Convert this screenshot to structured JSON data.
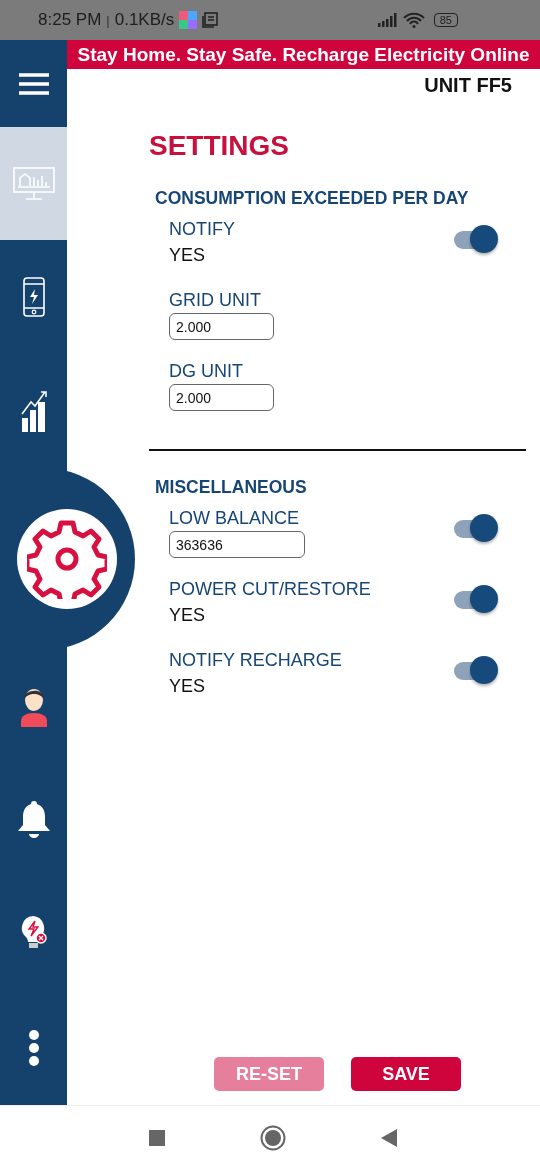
{
  "status_bar": {
    "time": "8:25 PM",
    "separator": "|",
    "speed": "0.1KB/s",
    "battery": "85"
  },
  "banner": "Stay Home. Stay Safe. Recharge Electricity Online",
  "unit": "UNIT FF5",
  "title": "SETTINGS",
  "sidebar": {
    "items": [
      {
        "selected": false,
        "highlighted": true
      },
      {
        "selected": false,
        "highlighted": false
      },
      {
        "selected": false,
        "highlighted": false
      },
      {
        "selected": true,
        "highlighted": false
      },
      {
        "selected": false,
        "highlighted": false
      },
      {
        "selected": false,
        "highlighted": false
      },
      {
        "selected": false,
        "highlighted": false
      },
      {
        "selected": false,
        "highlighted": false
      }
    ]
  },
  "sections": [
    {
      "title": "CONSUMPTION EXCEEDED PER DAY",
      "items": [
        {
          "kind": "toggle",
          "label": "NOTIFY",
          "value": "YES",
          "on": true
        },
        {
          "kind": "input",
          "label": "GRID UNIT",
          "value": "2.000"
        },
        {
          "kind": "input",
          "label": "DG UNIT",
          "value": "2.000"
        }
      ]
    },
    {
      "title": "MISCELLANEOUS",
      "items": [
        {
          "kind": "input_toggle",
          "label": "LOW BALANCE",
          "value": "363636",
          "on": true
        },
        {
          "kind": "toggle",
          "label": "POWER CUT/RESTORE",
          "value": "YES",
          "on": true
        },
        {
          "kind": "toggle",
          "label": "NOTIFY RECHARGE",
          "value": "YES",
          "on": true
        }
      ]
    }
  ],
  "buttons": [
    {
      "label": "RE-SET",
      "disabled": true
    },
    {
      "label": "SAVE",
      "disabled": false
    }
  ]
}
